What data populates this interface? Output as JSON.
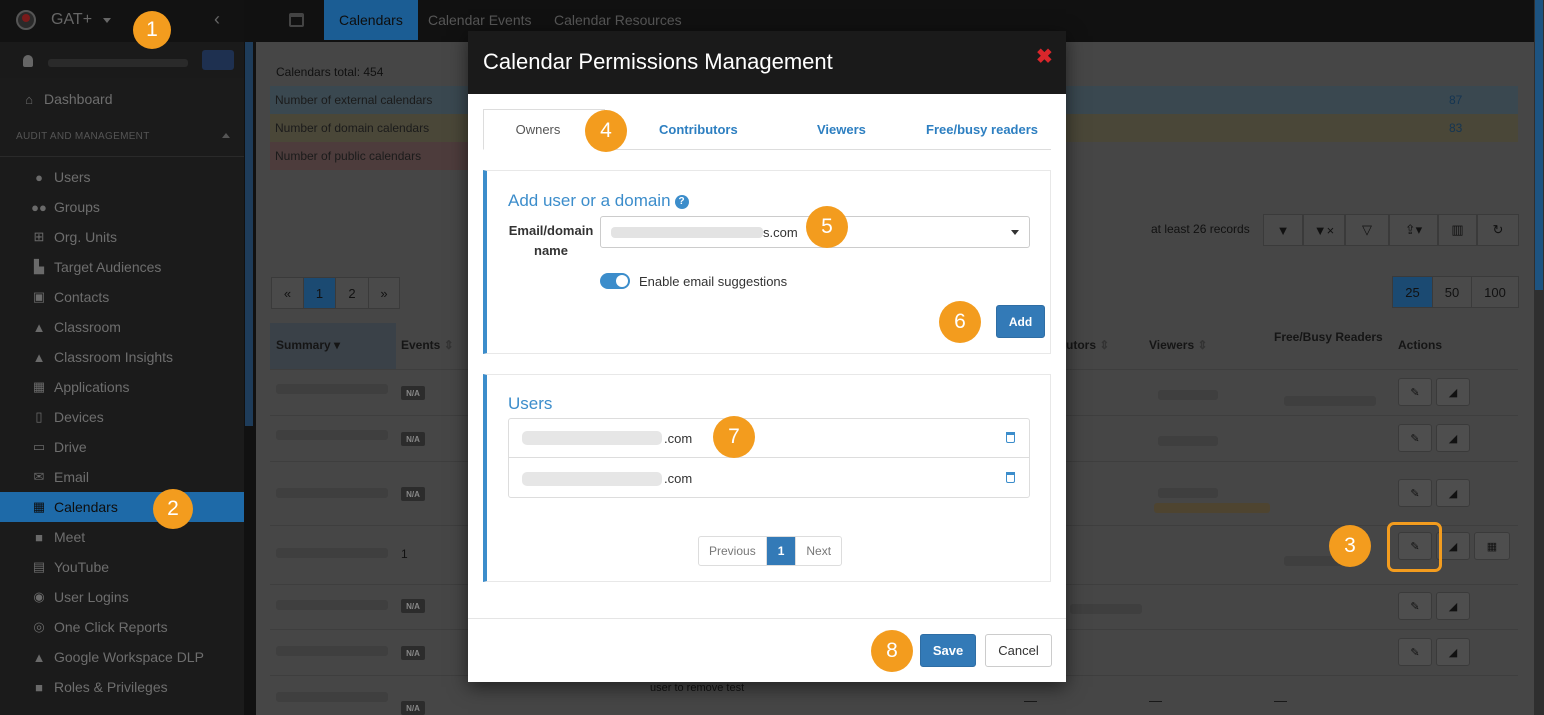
{
  "app": {
    "brand": "GAT+"
  },
  "sidebar": {
    "section": "AUDIT AND MANAGEMENT",
    "dashboard": "Dashboard",
    "items": [
      "Users",
      "Groups",
      "Org. Units",
      "Target Audiences",
      "Contacts",
      "Classroom",
      "Classroom Insights",
      "Applications",
      "Devices",
      "Drive",
      "Email",
      "Calendars",
      "Meet",
      "YouTube",
      "User Logins",
      "One Click Reports",
      "Google Workspace DLP",
      "Roles & Privileges"
    ],
    "active": "Calendars"
  },
  "topbar": {
    "tabs": [
      "Calendars",
      "Calendar Events",
      "Calendar Resources"
    ]
  },
  "stats": {
    "total": "Calendars total: 454",
    "rows": [
      {
        "label": "Number of external calendars",
        "value": "87"
      },
      {
        "label": "Number of domain calendars",
        "value": "83"
      },
      {
        "label": "Number of public calendars",
        "value": ""
      }
    ]
  },
  "records": "at least 26 records",
  "pagination": {
    "prev": "«",
    "pages": [
      "1",
      "2"
    ],
    "next": "»"
  },
  "page_size": [
    "25",
    "50",
    "100"
  ],
  "table": {
    "headers": [
      "Summary",
      "Events",
      "utors",
      "Viewers",
      "Free/Busy Readers",
      "Actions"
    ],
    "na": "N/A",
    "events_row4": "1",
    "partial_text": "user to remove test",
    "dashes": [
      "—",
      "—",
      "—"
    ]
  },
  "modal": {
    "title": "Calendar Permissions Management",
    "close": "✖",
    "tabs": [
      "Owners",
      "Contributors",
      "Viewers",
      "Free/busy readers"
    ],
    "add_title": "Add user or a domain",
    "help": "?",
    "email_label": "Email/domain name",
    "email_value_suffix": "s.com",
    "suggestions_label": "Enable email suggestions",
    "add_button": "Add",
    "users_title": "Users",
    "users": [
      ".com",
      ".com"
    ],
    "pager": {
      "prev": "Previous",
      "page": "1",
      "next": "Next"
    },
    "save": "Save",
    "cancel": "Cancel"
  },
  "badges": [
    "1",
    "2",
    "3",
    "4",
    "5",
    "6",
    "7",
    "8"
  ]
}
